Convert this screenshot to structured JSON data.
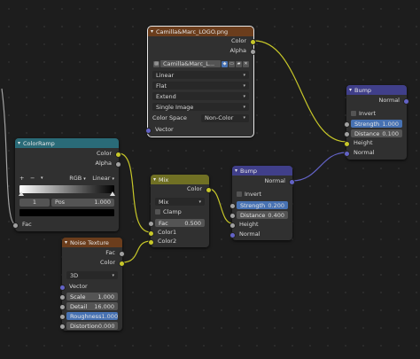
{
  "image_node": {
    "file": "Camilla&Marc_LOGO.png",
    "image_name": "Camilla&Marc_L...",
    "out_color": "Color",
    "out_alpha": "Alpha",
    "interpolation": "Linear",
    "projection": "Flat",
    "extension": "Extend",
    "source": "Single Image",
    "color_space_label": "Color Space",
    "color_space": "Non-Color",
    "in_vector": "Vector"
  },
  "colorramp_node": {
    "title": "ColorRamp",
    "out_color": "Color",
    "out_alpha": "Alpha",
    "plus": "+",
    "minus": "−",
    "mode": "RGB",
    "interp": "Linear",
    "stop_index": "1",
    "pos_label": "Pos",
    "pos_value": "1.000",
    "in_fac": "Fac",
    "gradient_start": "#ffffff",
    "gradient_end": "#000000"
  },
  "mix_node": {
    "title": "Mix",
    "out_color": "Color",
    "blend_mode": "Mix",
    "clamp_label": "Clamp",
    "fac_label": "Fac",
    "fac_value": "0.500",
    "in_color1": "Color1",
    "in_color2": "Color2"
  },
  "noise_node": {
    "title": "Noise Texture",
    "out_fac": "Fac",
    "out_color": "Color",
    "dimensions": "3D",
    "in_vector": "Vector",
    "scale_label": "Scale",
    "scale_value": "1.000",
    "detail_label": "Detail",
    "detail_value": "16.000",
    "roughness_label": "Roughness",
    "roughness_value": "1.000",
    "distortion_label": "Distortion",
    "distortion_value": "0.000"
  },
  "bump1_node": {
    "title": "Bump",
    "out_normal": "Normal",
    "invert_label": "Invert",
    "strength_label": "Strength",
    "strength_value": "0.200",
    "distance_label": "Distance",
    "distance_value": "0.400",
    "in_height": "Height",
    "in_normal": "Normal"
  },
  "bump2_node": {
    "title": "Bump",
    "out_normal": "Normal",
    "invert_label": "Invert",
    "strength_label": "Strength",
    "strength_value": "1.000",
    "distance_label": "Distance",
    "distance_value": "0.100",
    "in_height": "Height",
    "in_normal": "Normal"
  },
  "colors": {
    "texture_header": "#6b3d1c",
    "converter_header": "#2a6b78",
    "color_header": "#707024",
    "vector_header": "#403f8a",
    "color_socket": "#c7c729",
    "float_socket": "#a1a1a1",
    "vector_socket": "#6363c7",
    "active_field": "#4772b3"
  }
}
